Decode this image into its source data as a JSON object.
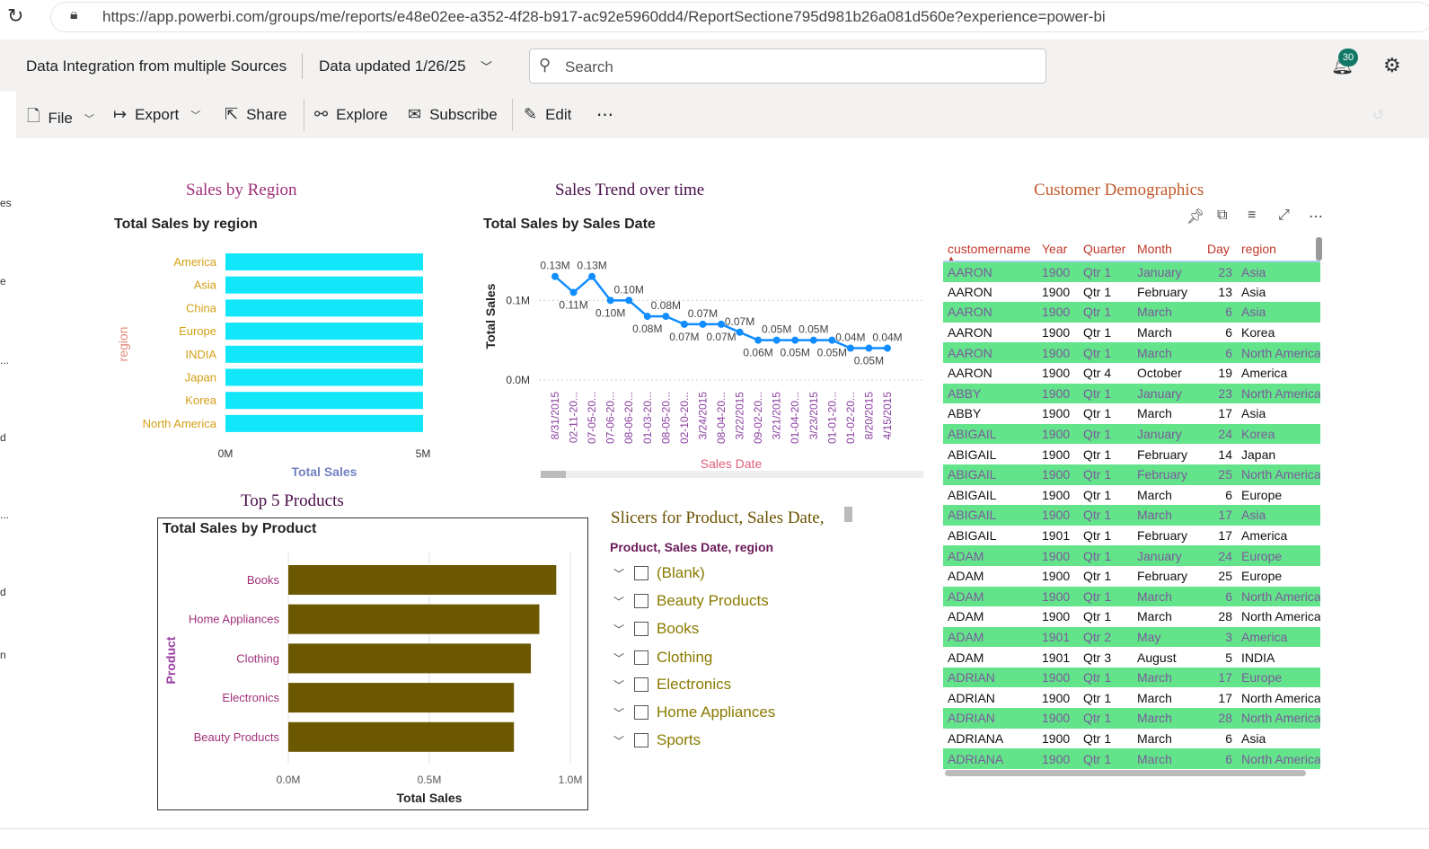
{
  "browser": {
    "url": "https://app.powerbi.com/groups/me/reports/e48e02ee-a352-4f28-b917-ac92e5960dd4/ReportSectione795d981b26a081d560e?experience=power-bi",
    "reload_icon": "reload-icon",
    "lock_icon": "lock-icon"
  },
  "header": {
    "report_title": "Data Integration from multiple Sources",
    "data_updated": "Data updated 1/26/25",
    "search_placeholder": "Search",
    "notification_count": "30"
  },
  "toolbar": {
    "file": "File",
    "export": "Export",
    "share": "Share",
    "explore": "Explore",
    "subscribe": "Subscribe",
    "edit": "Edit",
    "more": "⋯"
  },
  "left_strip": [
    "es",
    "e",
    "...",
    "d",
    "...",
    "d",
    "n"
  ],
  "visuals": {
    "sales_by_region": {
      "title": "Sales by Region",
      "subtitle": "Total Sales by region"
    },
    "sales_trend": {
      "title": "Sales Trend over time",
      "subtitle": "Total Sales by Sales Date"
    },
    "customer_demo": {
      "title": "Customer Demographics"
    },
    "top5": {
      "title": "Top 5 Products",
      "subtitle": "Total Sales by Product"
    },
    "slicers": {
      "title": "Slicers for Product, Sales Date,",
      "category": "Product, Sales Date, region",
      "items": [
        "(Blank)",
        "Beauty Products",
        "Books",
        "Clothing",
        "Electronics",
        "Home Appliances",
        "Sports"
      ]
    }
  },
  "chart_data": [
    {
      "type": "bar",
      "orientation": "horizontal",
      "title": "Total Sales by region",
      "categories": [
        "America",
        "Asia",
        "China",
        "Europe",
        "INDIA",
        "Japan",
        "Korea",
        "North America"
      ],
      "values": [
        5.0,
        5.0,
        5.0,
        5.0,
        5.0,
        5.0,
        5.0,
        5.0
      ],
      "unit": "M",
      "xlabel": "Total Sales",
      "ylabel": "region",
      "xlim": [
        0,
        5
      ],
      "xticks": [
        "0M",
        "5M"
      ],
      "colors": {
        "bar": "#12e6f9",
        "category_label": "#d4a017",
        "axis_title": "#7280c4",
        "ylabel": "#e38b7b"
      }
    },
    {
      "type": "line",
      "title": "Total Sales by Sales Date",
      "x": [
        "8/31/2015",
        "02-11-20...",
        "07-05-20...",
        "07-06-20...",
        "08-06-20...",
        "01-03-20...",
        "08-05-20...",
        "02-10-20...",
        "3/24/2015",
        "08-04-20...",
        "3/22/2015",
        "09-02-20...",
        "3/21/2015",
        "01-04-20...",
        "3/23/2015",
        "01-01-20...",
        "01-02-20...",
        "8/20/2015",
        "4/15/2015"
      ],
      "values": [
        0.13,
        0.11,
        0.13,
        0.1,
        0.1,
        0.08,
        0.08,
        0.07,
        0.07,
        0.07,
        0.06,
        0.05,
        0.05,
        0.05,
        0.05,
        0.05,
        0.04,
        0.04,
        0.04
      ],
      "data_labels": [
        "0.13M",
        "0.11M",
        "0.13M",
        "0.10M",
        "0.10M",
        "0.08M",
        "0.08M",
        "0.07M",
        "0.07M",
        "0.07M",
        "0.07M",
        "0.06M",
        "0.05M",
        "0.05M",
        "0.05M",
        "0.05M",
        "0.04M",
        "0.05M",
        "0.04M"
      ],
      "xlabel": "Sales Date",
      "ylabel": "Total Sales",
      "yticks": [
        "0.0M",
        "0.1M"
      ],
      "ylim": [
        0,
        0.15
      ],
      "colors": {
        "line": "#118dff",
        "xtick": "#8a3fa0",
        "xlabel": "#e0607e"
      }
    },
    {
      "type": "bar",
      "orientation": "horizontal",
      "title": "Total Sales by Product",
      "categories": [
        "Books",
        "Home Appliances",
        "Clothing",
        "Electronics",
        "Beauty Products"
      ],
      "values": [
        0.95,
        0.89,
        0.86,
        0.8,
        0.8
      ],
      "unit": "M",
      "xlabel": "Total Sales",
      "ylabel": "Product",
      "xlim": [
        0,
        1.0
      ],
      "xticks": [
        "0.0M",
        "0.5M",
        "1.0M"
      ],
      "colors": {
        "bar": "#6b5800",
        "category_label": "#a0307a",
        "ylabel": "#9b3fa2"
      }
    }
  ],
  "table": {
    "columns": [
      "customername",
      "Year",
      "Quarter",
      "Month",
      "Day",
      "region"
    ],
    "rows": [
      [
        "AARON",
        "1900",
        "Qtr 1",
        "January",
        "23",
        "Asia"
      ],
      [
        "AARON",
        "1900",
        "Qtr 1",
        "February",
        "13",
        "Asia"
      ],
      [
        "AARON",
        "1900",
        "Qtr 1",
        "March",
        "6",
        "Asia"
      ],
      [
        "AARON",
        "1900",
        "Qtr 1",
        "March",
        "6",
        "Korea"
      ],
      [
        "AARON",
        "1900",
        "Qtr 1",
        "March",
        "6",
        "North America"
      ],
      [
        "AARON",
        "1900",
        "Qtr 4",
        "October",
        "19",
        "America"
      ],
      [
        "ABBY",
        "1900",
        "Qtr 1",
        "January",
        "23",
        "North America"
      ],
      [
        "ABBY",
        "1900",
        "Qtr 1",
        "March",
        "17",
        "Asia"
      ],
      [
        "ABIGAIL",
        "1900",
        "Qtr 1",
        "January",
        "24",
        "Korea"
      ],
      [
        "ABIGAIL",
        "1900",
        "Qtr 1",
        "February",
        "14",
        "Japan"
      ],
      [
        "ABIGAIL",
        "1900",
        "Qtr 1",
        "February",
        "25",
        "North America"
      ],
      [
        "ABIGAIL",
        "1900",
        "Qtr 1",
        "March",
        "6",
        "Europe"
      ],
      [
        "ABIGAIL",
        "1900",
        "Qtr 1",
        "March",
        "17",
        "Asia"
      ],
      [
        "ABIGAIL",
        "1901",
        "Qtr 1",
        "February",
        "17",
        "America"
      ],
      [
        "ADAM",
        "1900",
        "Qtr 1",
        "January",
        "24",
        "Europe"
      ],
      [
        "ADAM",
        "1900",
        "Qtr 1",
        "February",
        "25",
        "Europe"
      ],
      [
        "ADAM",
        "1900",
        "Qtr 1",
        "March",
        "6",
        "North America"
      ],
      [
        "ADAM",
        "1900",
        "Qtr 1",
        "March",
        "28",
        "North America"
      ],
      [
        "ADAM",
        "1901",
        "Qtr 2",
        "May",
        "3",
        "America"
      ],
      [
        "ADAM",
        "1901",
        "Qtr 3",
        "August",
        "5",
        "INDIA"
      ],
      [
        "ADRIAN",
        "1900",
        "Qtr 1",
        "March",
        "17",
        "Europe"
      ],
      [
        "ADRIAN",
        "1900",
        "Qtr 1",
        "March",
        "17",
        "North America"
      ],
      [
        "ADRIAN",
        "1900",
        "Qtr 1",
        "March",
        "28",
        "North America"
      ],
      [
        "ADRIANA",
        "1900",
        "Qtr 1",
        "March",
        "6",
        "Asia"
      ],
      [
        "ADRIANA",
        "1900",
        "Qtr 1",
        "March",
        "6",
        "North America"
      ]
    ],
    "colors": {
      "highlight_row": "#63e38a",
      "header": "#c0392b"
    }
  }
}
